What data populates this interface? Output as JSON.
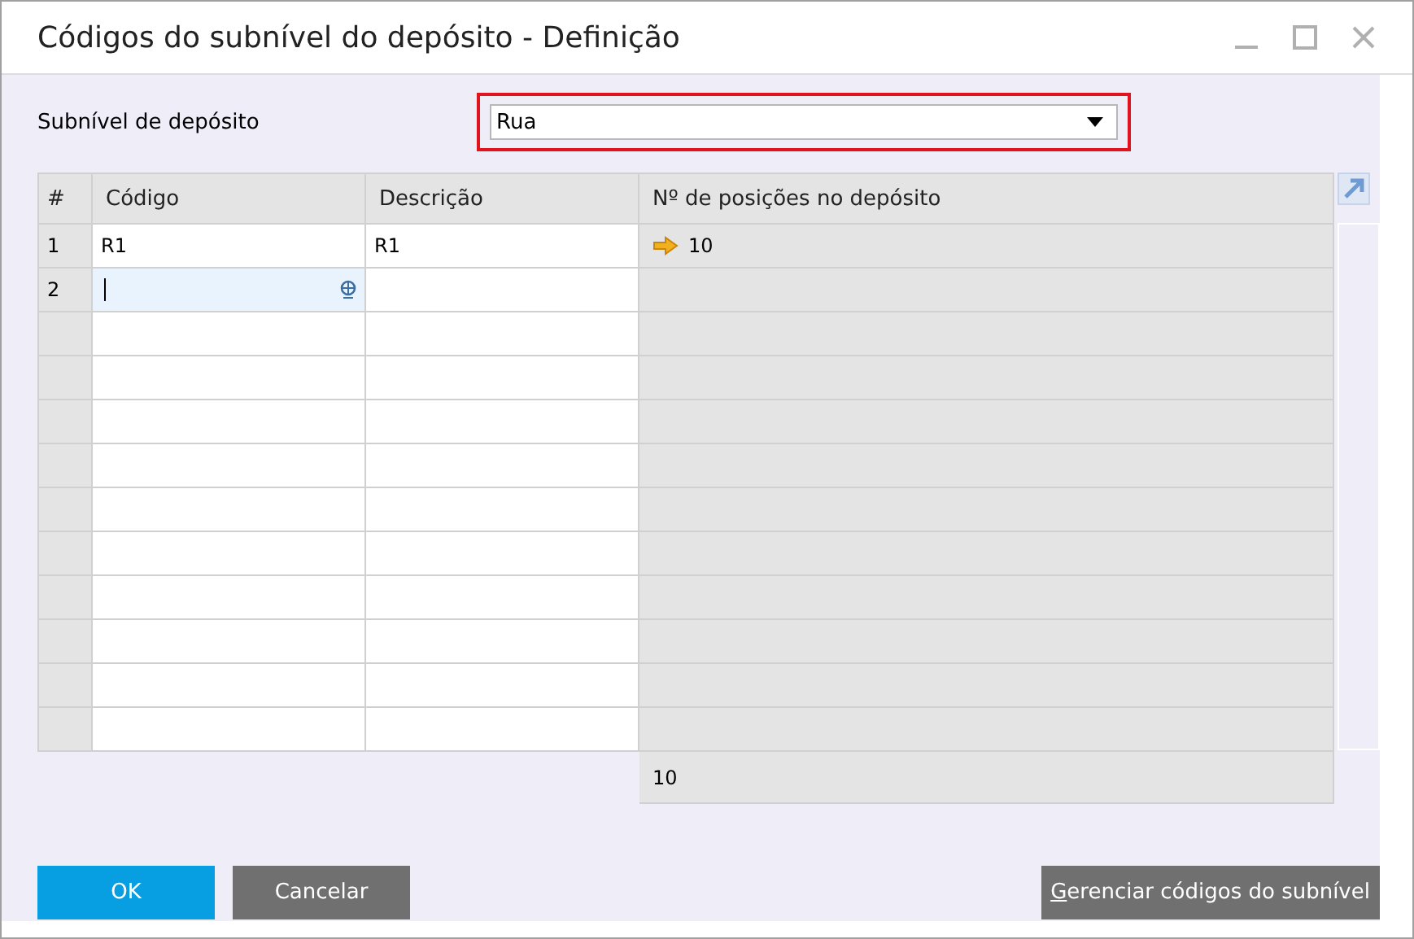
{
  "window": {
    "title": "Códigos do subnível do depósito - Definição"
  },
  "subnivel": {
    "label": "Subnível de depósito",
    "value": "Rua",
    "highlighted": true
  },
  "table": {
    "columns": [
      "#",
      "Código",
      "Descrição",
      "Nº de posições no depósito"
    ],
    "rows": [
      {
        "number": "1",
        "codigo": "R1",
        "descricao": "R1",
        "posicoes": "10",
        "selected": false
      },
      {
        "number": "2",
        "codigo": "",
        "descricao": "",
        "posicoes": "",
        "selected": true
      }
    ],
    "total": "10"
  },
  "buttons": [
    {
      "label": "OK",
      "kind": "primary"
    },
    {
      "label": "Cancelar",
      "kind": "secondary"
    },
    {
      "label": "Gerenciar códigos do subnível",
      "kind": "secondary"
    }
  ]
}
